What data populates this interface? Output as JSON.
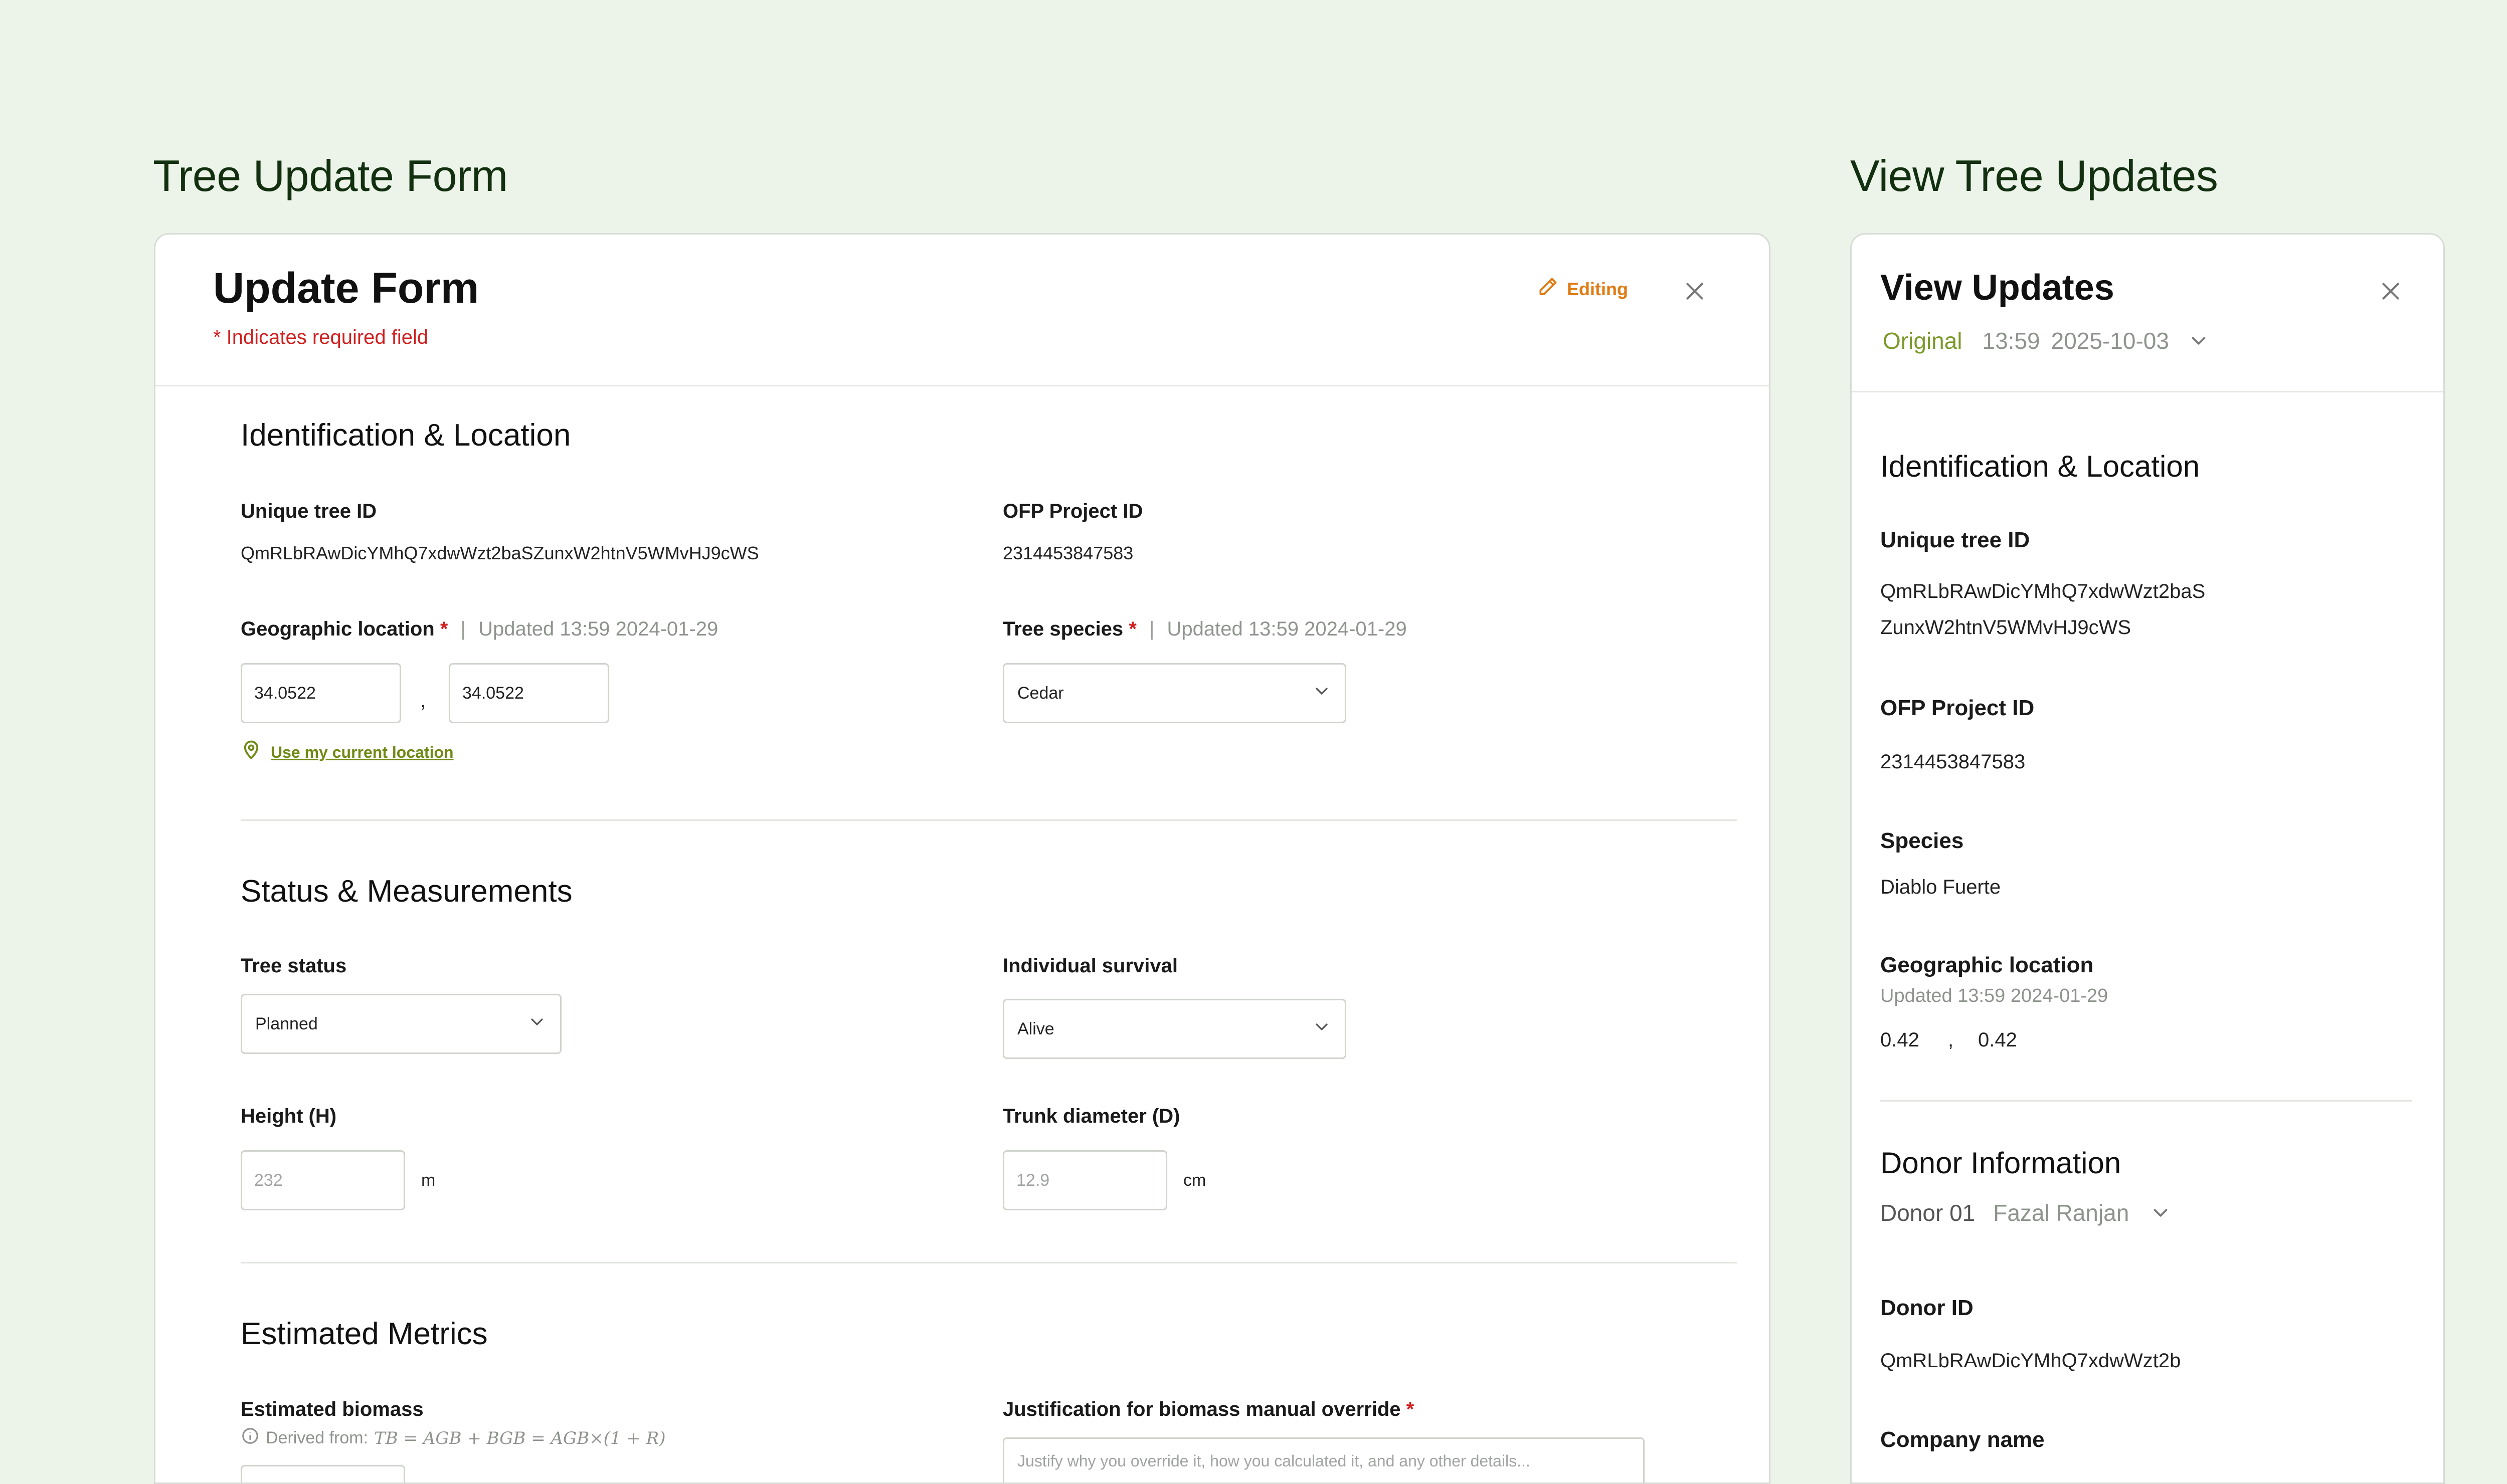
{
  "headings": {
    "left": "Tree Update Form",
    "right": "View Tree Updates"
  },
  "form": {
    "title": "Update Form",
    "required_note": "* Indicates required field",
    "editing_label": "Editing",
    "identification": {
      "title": "Identification & Location",
      "unique_id_label": "Unique tree ID",
      "unique_id_value": "QmRLbRAwDicYMhQ7xdwWzt2baSZunxW2htnV5WMvHJ9cWS",
      "ofp_label": "OFP Project ID",
      "ofp_value": "2314453847583",
      "geo_label": "Geographic location",
      "required_mark": "*",
      "separator": "|",
      "geo_updated": "Updated 13:59 2024-01-29",
      "lat": "34.0522",
      "lng": "34.0522",
      "comma": ",",
      "use_location": "Use my current location",
      "species_label": "Tree species",
      "species_updated": "Updated 13:59 2024-01-29",
      "species_value": "Cedar"
    },
    "status": {
      "title": "Status & Measurements",
      "tree_status_label": "Tree status",
      "tree_status_value": "Planned",
      "survival_label": "Individual survival",
      "survival_value": "Alive",
      "height_label": "Height (H)",
      "height_placeholder": "232",
      "height_unit": "m",
      "trunk_label": "Trunk diameter (D)",
      "trunk_placeholder": "12.9",
      "trunk_unit": "cm"
    },
    "metrics": {
      "title": "Estimated Metrics",
      "biomass_label": "Estimated biomass",
      "derived_label": "Derived from:",
      "formula": "TB = AGB + BGB = AGB×(1 + R)",
      "justification_label": "Justification for biomass manual override",
      "justification_placeholder": "Justify why you override it, how you calculated it, and any other details..."
    }
  },
  "view": {
    "title": "View Updates",
    "version_label": "Original",
    "version_time": "13:59",
    "version_date": "2025-10-03",
    "identification_title": "Identification & Location",
    "unique_id_label": "Unique tree ID",
    "unique_id_line1": "QmRLbRAwDicYMhQ7xdwWzt2baS",
    "unique_id_line2": "ZunxW2htnV5WMvHJ9cWS",
    "ofp_label": "OFP Project ID",
    "ofp_value": "2314453847583",
    "species_label": "Species",
    "species_value": "Diablo Fuerte",
    "geo_label": "Geographic location",
    "geo_updated": "Updated 13:59 2024-01-29",
    "lat": "0.42",
    "comma": ",",
    "lng": "0.42",
    "donor_title": "Donor Information",
    "donor_number": "Donor 01",
    "donor_name": "Fazal Ranjan",
    "donor_id_label": "Donor ID",
    "donor_id_value": "QmRLbRAwDicYMhQ7xdwWzt2b",
    "company_label": "Company name"
  },
  "colors": {
    "background": "#ecf3e9",
    "heading": "#12300f",
    "required": "#d01f1f",
    "editing": "#e07a12",
    "link": "#6f8a14",
    "original": "#7b9a2a"
  },
  "icons": [
    "pencil-icon",
    "close-icon",
    "location-pin-icon",
    "chevron-down-icon",
    "info-icon"
  ]
}
